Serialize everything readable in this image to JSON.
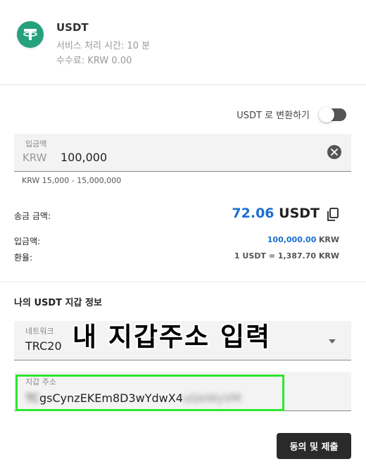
{
  "coin": {
    "name": "USDT",
    "processing_time": "서비스 처리 시간: 10 분",
    "fee": "수수료: KRW 0.00",
    "icon": "tether-logo-icon",
    "brand_color": "#26a17b"
  },
  "convert_toggle": {
    "label": "USDT 로 변환하기",
    "state": "off"
  },
  "deposit": {
    "label": "입금액",
    "currency": "KRW",
    "value": "100,000",
    "range": "KRW 15,000 - 15,000,000"
  },
  "send": {
    "label": "송금 금액:",
    "value": "72.06",
    "unit": "USDT"
  },
  "details": {
    "deposit_label": "입금액:",
    "deposit_value": "100,000.00",
    "deposit_unit": "KRW",
    "rate_label": "환율:",
    "rate_value": "1 USDT = 1,387.70 KRW"
  },
  "wallet": {
    "section_title": "나의 USDT 지갑 정보",
    "network_label": "네트워크",
    "network_value": "TRC20",
    "address_label": "지갑 주소",
    "address_prefix": "TC",
    "address_visible": "gsCynzEKEm8D3wYdwX4",
    "address_suffix": "uQeWyVM",
    "overlay_annotation": "내 지갑주소 입력"
  },
  "submit_label": "동의 및 제출",
  "colors": {
    "accent_blue": "#1a6fd1",
    "highlight_green": "#2ee62e",
    "button_dark": "#2a2a2a"
  }
}
